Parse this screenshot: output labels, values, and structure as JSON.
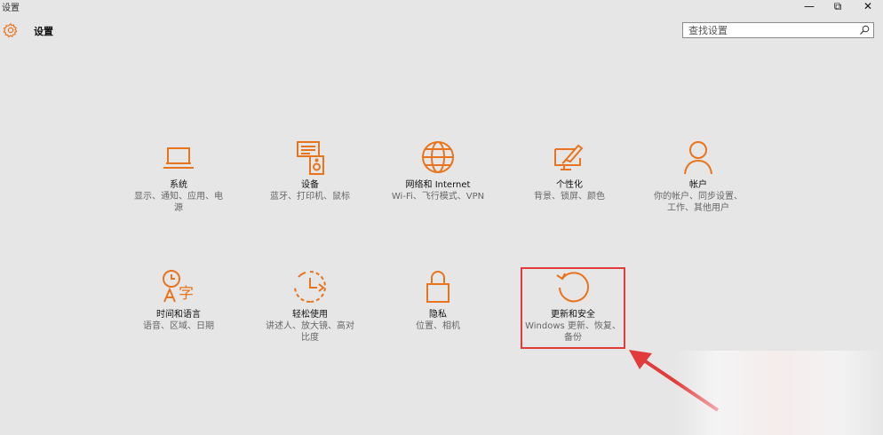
{
  "window": {
    "title": "设置",
    "minimize": "—",
    "restore": "⧉",
    "close": "✕"
  },
  "header": {
    "title": "设置",
    "icon": "gear-icon"
  },
  "search": {
    "placeholder": "查找设置",
    "icon": "search-icon"
  },
  "accent": "#e8741e",
  "tiles": [
    {
      "name": "系统",
      "desc": "显示、通知、应用、电源",
      "icon": "laptop-icon"
    },
    {
      "name": "设备",
      "desc": "蓝牙、打印机、鼠标",
      "icon": "devices-icon"
    },
    {
      "name": "网络和 Internet",
      "desc": "Wi-Fi、飞行模式、VPN",
      "icon": "globe-icon"
    },
    {
      "name": "个性化",
      "desc": "背景、锁屏、颜色",
      "icon": "paint-icon"
    },
    {
      "name": "帐户",
      "desc": "你的帐户、同步设置、工作、其他用户",
      "icon": "person-icon"
    },
    {
      "name": "时间和语言",
      "desc": "语音、区域、日期",
      "icon": "time-language-icon"
    },
    {
      "name": "轻松使用",
      "desc": "讲述人、放大镜、高对比度",
      "icon": "ease-of-access-icon"
    },
    {
      "name": "隐私",
      "desc": "位置、相机",
      "icon": "lock-icon"
    },
    {
      "name": "更新和安全",
      "desc": "Windows 更新、恢复、备份",
      "icon": "update-icon"
    }
  ],
  "annotation": {
    "highlight_color": "#e23b3b"
  }
}
